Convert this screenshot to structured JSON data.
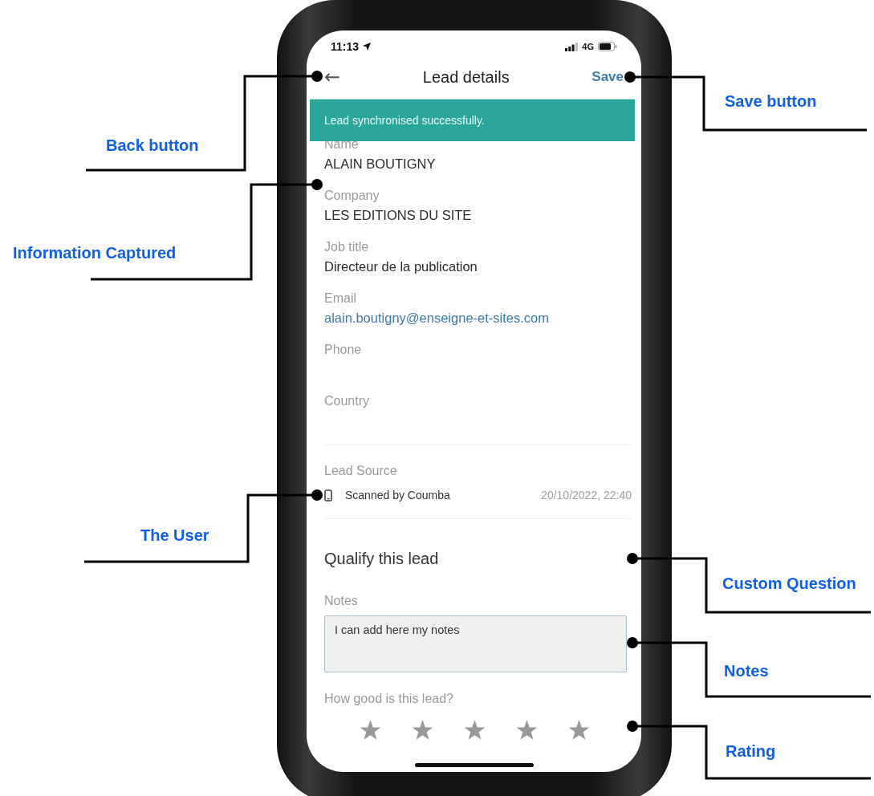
{
  "status_bar": {
    "time": "11:13",
    "network": "4G"
  },
  "header": {
    "back": "←",
    "title": "Lead details",
    "save": "Save"
  },
  "toast": {
    "message": "Lead synchronised successfully."
  },
  "fields": [
    {
      "label": "Name",
      "value": "ALAIN BOUTIGNY",
      "kind": "text"
    },
    {
      "label": "Company",
      "value": "LES EDITIONS DU SITE",
      "kind": "text"
    },
    {
      "label": "Job title",
      "value": "Directeur de la publication",
      "kind": "text"
    },
    {
      "label": "Email",
      "value": "alain.boutigny@enseigne-et-sites.com",
      "kind": "link"
    },
    {
      "label": "Phone"
    },
    {
      "label": "Country"
    }
  ],
  "lead_source": {
    "label": "Lead Source",
    "user": "Scanned by Coumba",
    "date": "20/10/2022, 22:40"
  },
  "qualify": {
    "title": "Qualify this lead",
    "notes": {
      "label": "Notes",
      "value": "I can add here my notes"
    },
    "rating": {
      "label": "How good is this lead?"
    }
  },
  "callouts": [
    {
      "label": "Back button"
    },
    {
      "label": "Information Captured"
    },
    {
      "label": "The User"
    },
    {
      "label": "Save button"
    },
    {
      "label": "Custom Question"
    },
    {
      "label": "Notes"
    },
    {
      "label": "Rating"
    }
  ]
}
